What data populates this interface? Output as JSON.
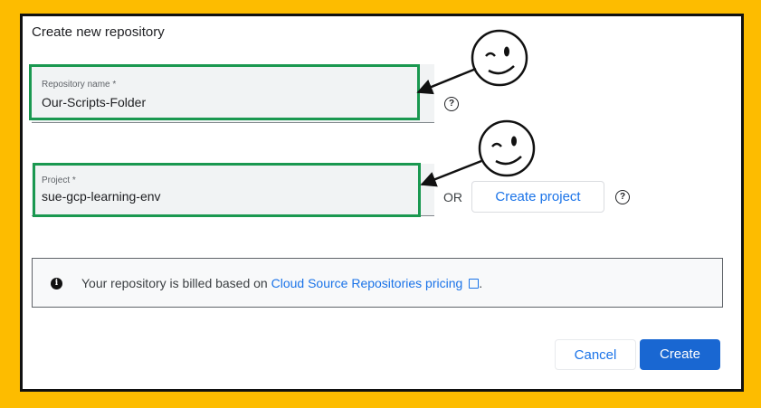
{
  "dialog": {
    "title": "Create new repository"
  },
  "repo_field": {
    "label": "Repository name *",
    "value": "Our-Scripts-Folder"
  },
  "project_field": {
    "label": "Project *",
    "value": "sue-gcp-learning-env"
  },
  "or_text": "OR",
  "create_project_label": "Create project",
  "help_glyph": "?",
  "notice": {
    "text_before": "Your repository is billed based on ",
    "link_text": "Cloud Source Repositories pricing",
    "text_after": ".",
    "info_glyph": "i"
  },
  "buttons": {
    "cancel": "Cancel",
    "create": "Create"
  },
  "colors": {
    "background": "#fdbc00",
    "highlight": "#1a9850",
    "accent": "#1a73e8",
    "primary": "#1967d2"
  },
  "icons": [
    "help-circle-icon",
    "info-icon",
    "external-link-icon",
    "wink-smiley-icon",
    "arrow-icon"
  ]
}
